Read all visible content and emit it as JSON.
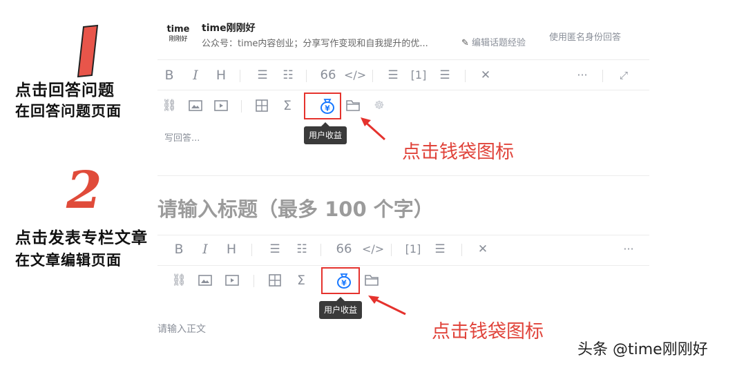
{
  "step1": {
    "number": "1",
    "line1": "点击回答问题",
    "line2": "在回答问题页面"
  },
  "step2": {
    "number": "2",
    "line1": "点击发表专栏文章",
    "line2": "在文章编辑页面"
  },
  "answer_panel": {
    "logo_text": "time",
    "logo_sub": "刚刚好",
    "user_name": "time刚刚好",
    "user_desc": "公众号：time内容创业；分享写作变现和自我提升的优...",
    "edit_link": "编辑话题经验",
    "anon_link": "使用匿名身份回答",
    "toolbar1": [
      "B",
      "I",
      "H",
      "ordered-list",
      "unordered-list",
      "66",
      "</>",
      "indent",
      "[1]",
      "divider",
      "clear-format",
      "···",
      "expand"
    ],
    "toolbar2": [
      "link",
      "image",
      "video",
      "table",
      "Σ",
      "money-bag",
      "folder",
      "bug"
    ],
    "tooltip": "用户收益",
    "placeholder": "写回答...",
    "annotation": "点击钱袋图标"
  },
  "article_panel": {
    "title_placeholder": "请输入标题（最多 100 个字）",
    "toolbar1": [
      "B",
      "I",
      "H",
      "ordered-list",
      "unordered-list",
      "66",
      "</>",
      "[1]",
      "divider",
      "clear-format",
      "···"
    ],
    "toolbar2": [
      "link",
      "image",
      "video",
      "table",
      "Σ",
      "money-bag",
      "folder"
    ],
    "tooltip": "用户收益",
    "body_placeholder": "请输入正文",
    "annotation": "点击钱袋图标"
  },
  "watermark": "头条 @time刚刚好",
  "colors": {
    "accent_red": "#e5322d",
    "icon_blue": "#1677ff",
    "icon_gray": "#8a8f99"
  }
}
